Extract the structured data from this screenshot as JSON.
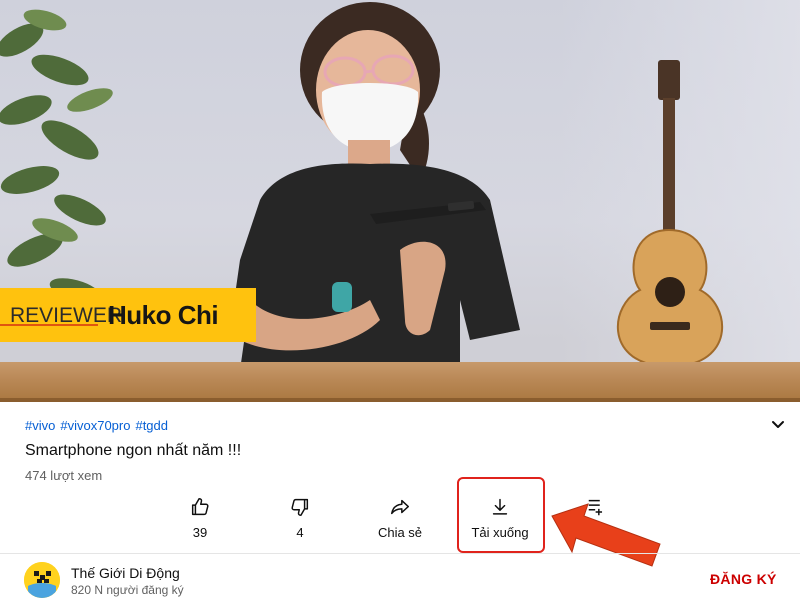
{
  "video": {
    "overlay_role": "REVIEWER",
    "overlay_name": "Huko Chi",
    "overlay_color": "#ffc20e"
  },
  "meta": {
    "hashtags": [
      "#vivo",
      "#vivox70pro",
      "#tgdd"
    ],
    "title": "Smartphone ngon nhất năm !!!",
    "views": "474 lượt xem",
    "expand_icon": "chevron-down-icon"
  },
  "actions": {
    "like": {
      "icon": "thumbs-up-icon",
      "label": "39"
    },
    "dislike": {
      "icon": "thumbs-down-icon",
      "label": "4"
    },
    "share": {
      "icon": "share-icon",
      "label": "Chia sẻ"
    },
    "download": {
      "icon": "download-icon",
      "label": "Tải xuống",
      "highlight_color": "#e0231c"
    },
    "save": {
      "icon": "save-playlist-icon"
    }
  },
  "annotation": {
    "arrow_color": "#e8401a"
  },
  "channel": {
    "name": "Thế Giới Di Động",
    "subscribers": "820 N người đăng ký",
    "subscribe_label": "ĐĂNG KÝ",
    "subscribe_color": "#cc0000"
  }
}
